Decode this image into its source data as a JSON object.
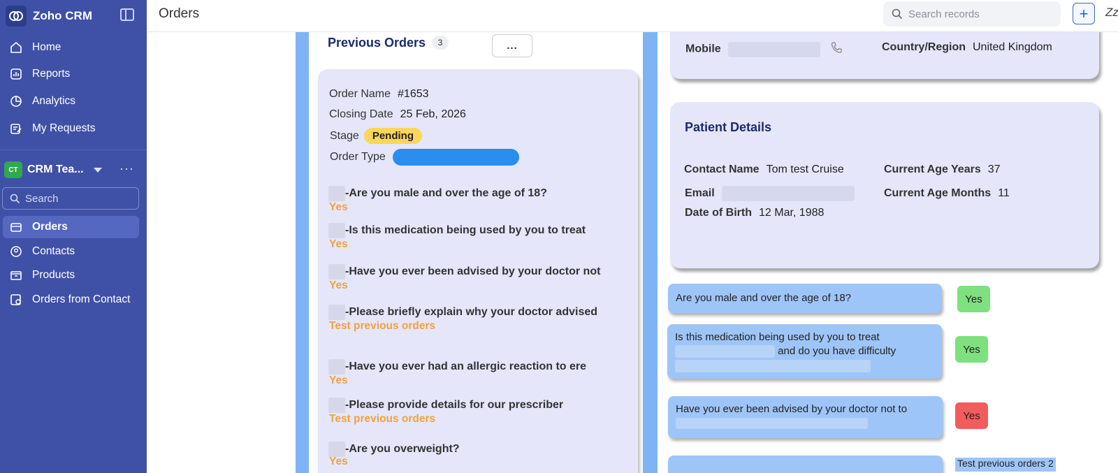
{
  "brand": {
    "name": "Zoho CRM"
  },
  "nav_top": [
    {
      "label": "Home",
      "icon": "home-icon"
    },
    {
      "label": "Reports",
      "icon": "reports-icon"
    },
    {
      "label": "Analytics",
      "icon": "analytics-icon"
    },
    {
      "label": "My Requests",
      "icon": "requests-icon"
    }
  ],
  "team": {
    "badge": "CT",
    "name": "CRM Tea..."
  },
  "sidebar_search": {
    "placeholder": "Search"
  },
  "nav_modules": [
    {
      "label": "Orders",
      "icon": "orders-icon",
      "active": true
    },
    {
      "label": "Contacts",
      "icon": "contacts-icon",
      "active": false
    },
    {
      "label": "Products",
      "icon": "products-icon",
      "active": false
    },
    {
      "label": "Orders from Contact",
      "icon": "orders-from-contact-icon",
      "active": false
    }
  ],
  "header": {
    "title": "Orders",
    "search_placeholder": "Search records",
    "plus": "+",
    "zz": "Zz"
  },
  "previous_orders": {
    "title": "Previous Orders",
    "count": "3",
    "more": "...",
    "order": {
      "order_name_label": "Order Name",
      "order_name": "#1653",
      "closing_date_label": "Closing Date",
      "closing_date": "25 Feb, 2026",
      "stage_label": "Stage",
      "stage": "Pending",
      "order_type_label": "Order Type"
    },
    "questions": [
      {
        "q": "-Are you male and over the age of 18?",
        "a": "Yes"
      },
      {
        "q": "-Is this medication being used by you to treat",
        "a": "Yes"
      },
      {
        "q": "-Have you ever been advised by your doctor not",
        "a": "Yes"
      },
      {
        "q": "-Please briefly explain why your doctor advised",
        "a": "Test previous orders"
      },
      {
        "q": "-Have you ever had an allergic reaction to ere",
        "a": "Yes"
      },
      {
        "q": "-Please provide details for our prescriber",
        "a": "Test previous orders"
      },
      {
        "q": "-Are you overweight?",
        "a": "Yes"
      }
    ]
  },
  "contact_card": {
    "mobile_label": "Mobile",
    "country_label": "Country/Region",
    "country": "United Kingdom"
  },
  "patient": {
    "title": "Patient Details",
    "contact_name_label": "Contact Name",
    "contact_name": "Tom test Cruise",
    "email_label": "Email",
    "dob_label": "Date of Birth",
    "dob": "12 Mar, 1988",
    "age_years_label": "Current Age Years",
    "age_years": "37",
    "age_months_label": "Current Age Months",
    "age_months": "11"
  },
  "answers": [
    {
      "q": "Are you male and over the age of 18?",
      "a": "Yes",
      "color": "#7ee07e"
    },
    {
      "q": "Is this medication being used by you to treat",
      "q2": "and do you have difficulty",
      "a": "Yes",
      "color": "#7ee07e"
    },
    {
      "q": "Have you ever been advised by your doctor not to",
      "a": "Yes",
      "color": "#f25c5c"
    },
    {
      "a": "Test previous orders 2"
    }
  ],
  "colors": {
    "sidebar": "#3f51a6",
    "accent_blue": "#7eb4f5",
    "card": "#e5e6fa",
    "answer_orange": "#f0a23c",
    "stage_yellow": "#fbd65a"
  }
}
